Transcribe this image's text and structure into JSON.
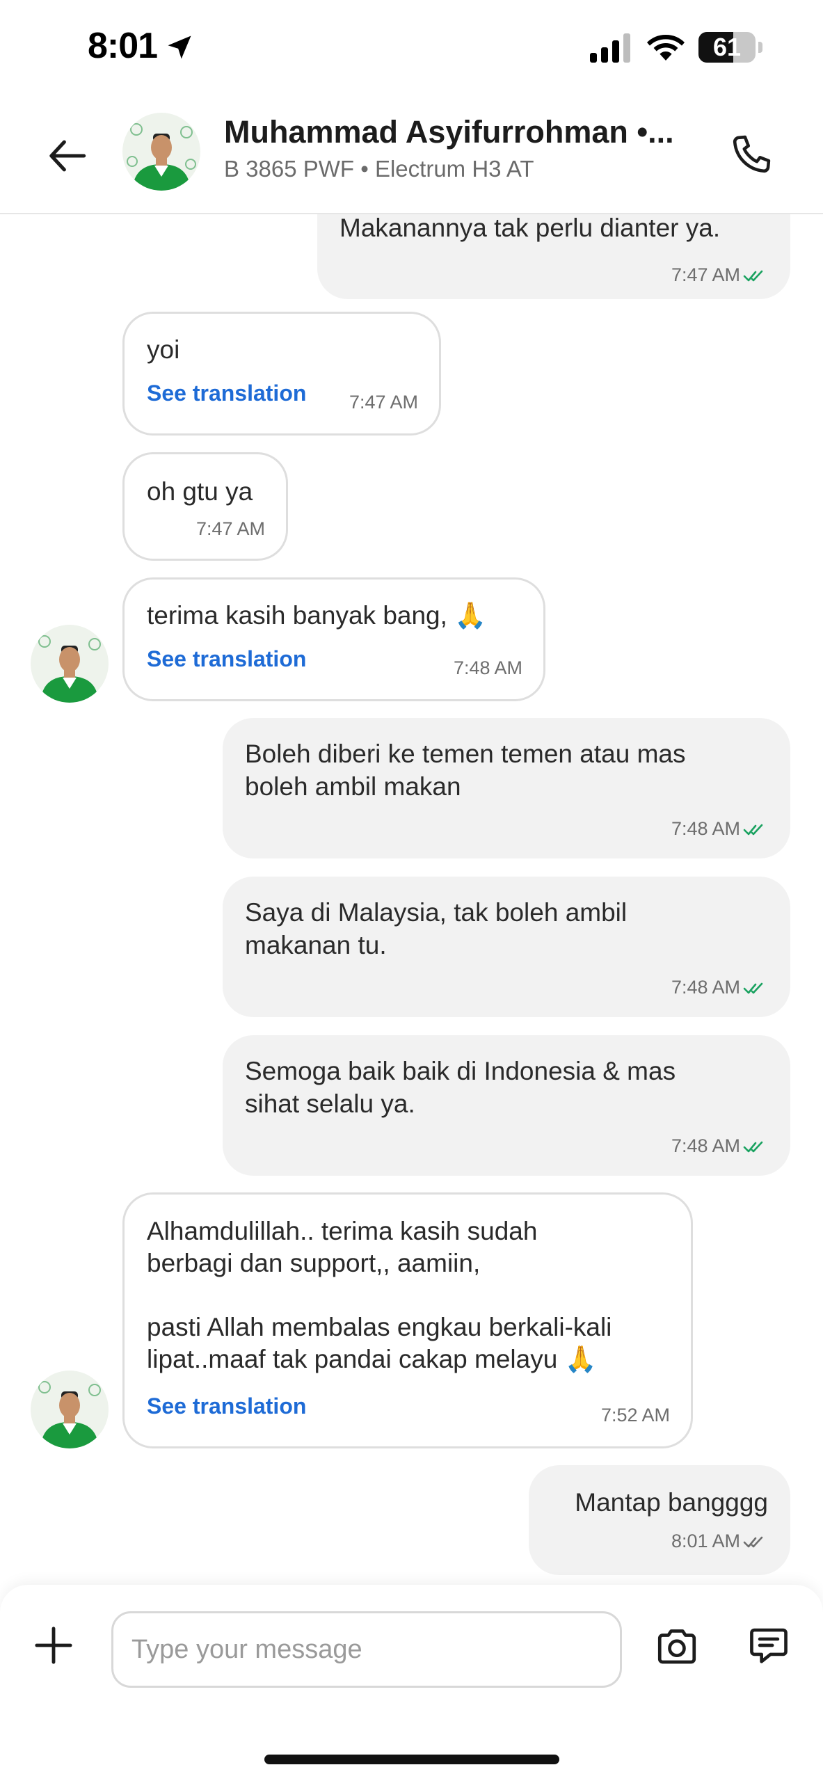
{
  "status_bar": {
    "time": "8:01",
    "battery": "61",
    "battery_level": 0.61
  },
  "header": {
    "name": "Muhammad Asyifurrohman •...",
    "subtitle": "B 3865 PWF • Electrum H3 AT"
  },
  "colors": {
    "link": "#1e6bd6",
    "read_tick": "#1aa260",
    "sent_tick": "#6e6e6e",
    "avatar_jacket": "#1a9a3e"
  },
  "icons": [
    "location-arrow-icon",
    "cellular-signal-icon",
    "wifi-icon",
    "battery-icon",
    "back-arrow-icon",
    "phone-icon",
    "plus-icon",
    "camera-icon",
    "chat-bubble-icon",
    "double-check-icon"
  ],
  "messages": [
    {
      "direction": "out",
      "text": "Makanannya tak perlu dianter ya.",
      "time": "7:47 AM",
      "status": "read"
    },
    {
      "direction": "in",
      "text": "yoi",
      "translation_link": "See translation",
      "time": "7:47 AM"
    },
    {
      "direction": "in",
      "text": "oh gtu ya",
      "time": "7:47 AM"
    },
    {
      "direction": "in",
      "text": "terima kasih banyak bang, 🙏",
      "translation_link": "See translation",
      "time": "7:48 AM"
    },
    {
      "direction": "out",
      "text": "Boleh diberi ke temen temen atau mas\nboleh ambil makan",
      "time": "7:48 AM",
      "status": "read"
    },
    {
      "direction": "out",
      "text": "Saya di Malaysia, tak boleh ambil\nmakanan tu.",
      "time": "7:48 AM",
      "status": "read"
    },
    {
      "direction": "out",
      "text": "Semoga baik baik di Indonesia & mas\nsihat selalu ya.",
      "time": "7:48 AM",
      "status": "read"
    },
    {
      "direction": "in",
      "text": "Alhamdulillah.. terima kasih sudah\nberbagi dan support,, aamiin,\n\npasti Allah membalas engkau berkali-kali\nlipat..maaf tak pandai cakap melayu 🙏",
      "translation_link": "See translation",
      "time": "7:52 AM"
    },
    {
      "direction": "out",
      "text": "Mantap bangggg",
      "time": "8:01 AM",
      "status": "sent"
    }
  ],
  "composer": {
    "placeholder": "Type your message",
    "value": ""
  }
}
